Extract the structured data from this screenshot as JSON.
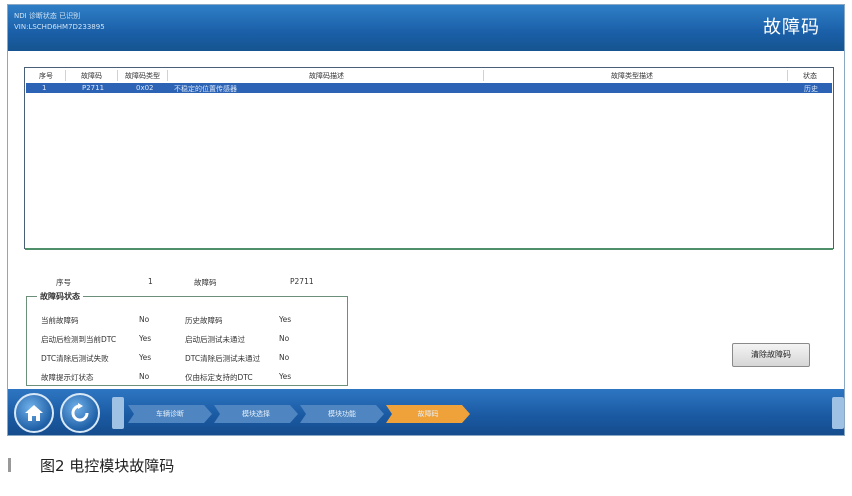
{
  "header": {
    "line1": "NDI 诊断状态  已识别",
    "line2": "VIN:LSCHD6HM7D233895",
    "title": "故障码"
  },
  "dtc_table": {
    "columns": [
      "序号",
      "故障码",
      "故障码类型",
      "故障码描述",
      "故障类型描述",
      "状态"
    ],
    "rows": [
      {
        "index": "1",
        "code": "P2711",
        "type": "0x02",
        "desc": "不稳定的位置传感器",
        "fault_desc": "",
        "status": "历史"
      }
    ]
  },
  "detail": {
    "index_label": "序号",
    "index_value": "1",
    "code_label": "故障码",
    "code_value": "P2711"
  },
  "status": {
    "legend": "故障码状态",
    "items": [
      {
        "label": "当前故障码",
        "value": "No"
      },
      {
        "label": "历史故障码",
        "value": "Yes"
      },
      {
        "label": "启动后检测到当前DTC",
        "value": "Yes"
      },
      {
        "label": "启动后测试未通过",
        "value": "No"
      },
      {
        "label": "DTC清除后测试失败",
        "value": "Yes"
      },
      {
        "label": "DTC清除后测试未通过",
        "value": "No"
      },
      {
        "label": "故障提示灯状态",
        "value": "No"
      },
      {
        "label": "仅由标定支持的DTC",
        "value": "Yes"
      }
    ]
  },
  "clear_button": "清除故障码",
  "breadcrumbs": [
    "车辆诊断",
    "模块选择",
    "模块功能",
    "故障码"
  ],
  "caption": "图2    电控模块故障码",
  "colors": {
    "header": "#1a5fa8",
    "selected_row": "#2d63b5",
    "active_crumb": "#f0a23a",
    "crumb": "#4f86c2"
  }
}
